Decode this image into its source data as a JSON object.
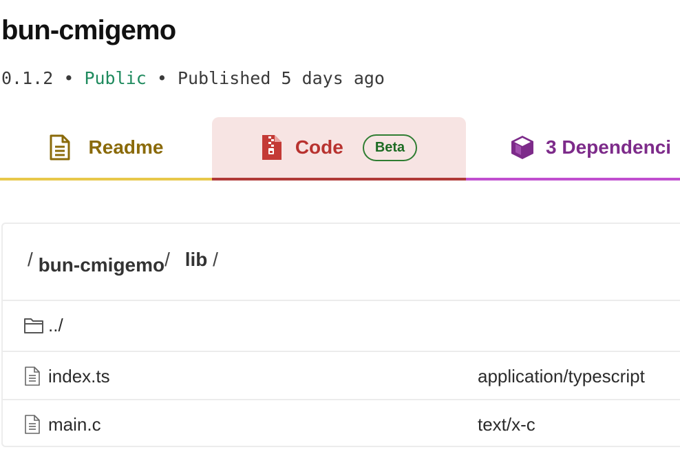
{
  "package": {
    "name": "bun-cmigemo",
    "version": "0.1.2",
    "separator": "•",
    "visibility": "Public",
    "published": "Published 5 days ago"
  },
  "tabs": [
    {
      "label": "Readme",
      "icon": "file-text-icon",
      "color": "#8a6a0a"
    },
    {
      "label": "Code",
      "icon": "file-zip-icon",
      "color": "#b8322f",
      "badge": "Beta",
      "active": true
    },
    {
      "label": "3 Dependenci",
      "icon": "cube-icon",
      "color": "#7d2b8a"
    }
  ],
  "breadcrumb": {
    "segments": [
      "bun-cmigemo",
      "lib"
    ],
    "separator": "/"
  },
  "files": {
    "parent": {
      "label": "../",
      "icon": "folder-icon"
    },
    "items": [
      {
        "name": "index.ts",
        "type": "application/typescript",
        "icon": "file-icon"
      },
      {
        "name": "main.c",
        "type": "text/x-c",
        "icon": "file-icon"
      }
    ]
  },
  "colors": {
    "public": "#1f8a5e",
    "readme_accent": "#e8c84a",
    "code_accent": "#b03a38",
    "code_bg": "#f7e4e3",
    "deps_accent": "#c04fcf",
    "beta": "#2f7d32"
  }
}
